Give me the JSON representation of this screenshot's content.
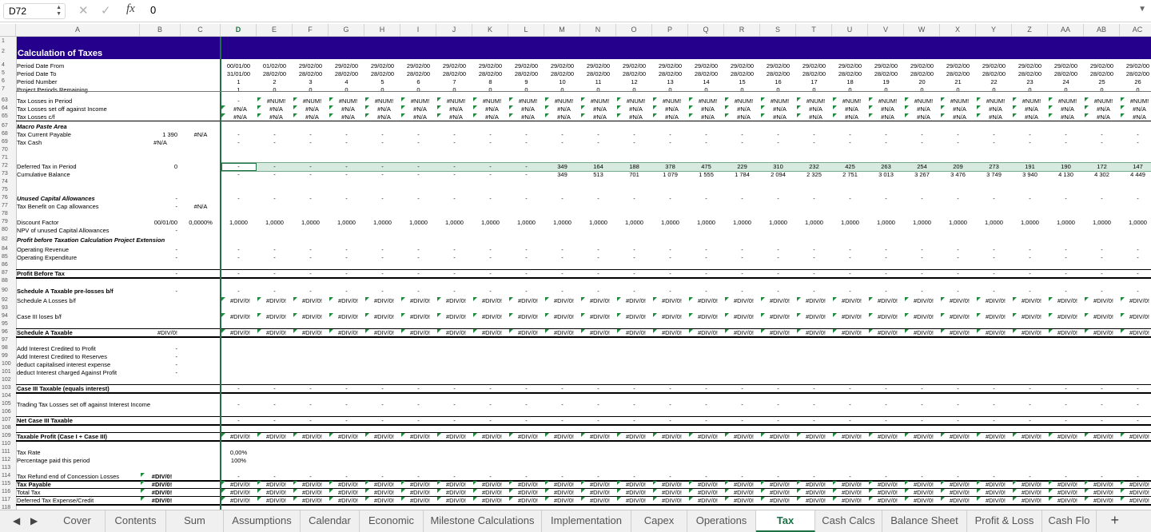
{
  "formula_bar": {
    "cell_ref": "D72",
    "cancel_icon": "close-icon",
    "confirm_icon": "check-icon",
    "fx_label": "fx",
    "formula": "0"
  },
  "columns": [
    {
      "id": "A"
    },
    {
      "id": "B"
    },
    {
      "id": "C"
    },
    {
      "id": "D"
    },
    {
      "id": "E"
    },
    {
      "id": "F"
    },
    {
      "id": "G"
    },
    {
      "id": "H"
    },
    {
      "id": "I"
    },
    {
      "id": "J"
    },
    {
      "id": "K"
    },
    {
      "id": "L"
    },
    {
      "id": "M"
    },
    {
      "id": "N"
    },
    {
      "id": "O"
    },
    {
      "id": "P"
    },
    {
      "id": "Q"
    },
    {
      "id": "R"
    },
    {
      "id": "S"
    },
    {
      "id": "T"
    },
    {
      "id": "U"
    },
    {
      "id": "V"
    },
    {
      "id": "W"
    },
    {
      "id": "X"
    },
    {
      "id": "Y"
    },
    {
      "id": "Z"
    },
    {
      "id": "AA"
    },
    {
      "id": "AB"
    },
    {
      "id": "AC"
    }
  ],
  "selected_column": "D",
  "title": "Calculation of Taxes",
  "header_rows": {
    "period_from": {
      "label": "Period Date From",
      "values": [
        "00/01/00",
        "01/02/00",
        "29/02/00",
        "29/02/00",
        "29/02/00",
        "29/02/00",
        "29/02/00",
        "29/02/00",
        "29/02/00",
        "29/02/00",
        "29/02/00",
        "29/02/00",
        "29/02/00",
        "29/02/00",
        "29/02/00",
        "29/02/00",
        "29/02/00",
        "29/02/00",
        "29/02/00",
        "29/02/00",
        "29/02/00",
        "29/02/00",
        "29/02/00",
        "29/02/00",
        "29/02/00",
        "29/02/00"
      ]
    },
    "period_to": {
      "label": "Period Date To",
      "values": [
        "31/01/00",
        "28/02/00",
        "28/02/00",
        "28/02/00",
        "28/02/00",
        "28/02/00",
        "28/02/00",
        "28/02/00",
        "28/02/00",
        "28/02/00",
        "28/02/00",
        "28/02/00",
        "28/02/00",
        "28/02/00",
        "28/02/00",
        "28/02/00",
        "28/02/00",
        "28/02/00",
        "28/02/00",
        "28/02/00",
        "28/02/00",
        "28/02/00",
        "28/02/00",
        "28/02/00",
        "28/02/00",
        "28/02/00"
      ]
    },
    "period_number": {
      "label": "Period Number",
      "values": [
        "1",
        "2",
        "3",
        "4",
        "5",
        "6",
        "7",
        "8",
        "9",
        "10",
        "11",
        "12",
        "13",
        "14",
        "15",
        "16",
        "17",
        "18",
        "19",
        "20",
        "21",
        "22",
        "23",
        "24",
        "25",
        "26"
      ]
    },
    "periods_remaining": {
      "label": "Project Periods Remaining",
      "values": [
        "1",
        "0",
        "0",
        "0",
        "0",
        "0",
        "0",
        "0",
        "0",
        "0",
        "0",
        "0",
        "0",
        "0",
        "0",
        "0",
        "0",
        "0",
        "0",
        "0",
        "0",
        "0",
        "0",
        "0",
        "0",
        "0"
      ]
    }
  },
  "rows": {
    "r63": {
      "label": "Tax Losses in Period",
      "d": "-",
      "rest": "#NUM!"
    },
    "r64": {
      "label": "Tax Losses set off against Income",
      "d": "#N/A",
      "rest": "#N/A"
    },
    "r65": {
      "label": "Tax Losses c/f",
      "d": "#N/A",
      "rest": "#N/A"
    },
    "r67": {
      "label": "Macro Paste Area"
    },
    "r68": {
      "label": "Tax Current Payable",
      "b": "1 390",
      "c": "#N/A",
      "dash": "-"
    },
    "r69": {
      "label": "Tax Cash",
      "b": "#N/A",
      "dash": "-"
    },
    "r72": {
      "label": "Deferred Tax in Period",
      "b": "0",
      "d": "-",
      "values": [
        "-",
        "-",
        "-",
        "-",
        "-",
        "-",
        "-",
        "-",
        "-",
        "349",
        "164",
        "188",
        "378",
        "475",
        "229",
        "310",
        "232",
        "425",
        "263",
        "254",
        "209",
        "273",
        "191",
        "190",
        "172",
        "147"
      ]
    },
    "r73": {
      "label": "Cumulative Balance",
      "values": [
        "-",
        "-",
        "-",
        "-",
        "-",
        "-",
        "-",
        "-",
        "-",
        "349",
        "513",
        "701",
        "1 079",
        "1 555",
        "1 784",
        "2 094",
        "2 325",
        "2 751",
        "3 013",
        "3 267",
        "3 476",
        "3 749",
        "3 940",
        "4 130",
        "4 302",
        "4 449"
      ]
    },
    "r76": {
      "label": "Unused Capital Allowances",
      "b": "-",
      "dash": "-"
    },
    "r77": {
      "label": "Tax Benefit on Cap allowances",
      "b": "-",
      "c": "#N/A"
    },
    "r79": {
      "label": "Discount Factor",
      "b": "00/01/00",
      "c": "0,0000%",
      "value": "1,0000"
    },
    "r80": {
      "label": "NPV of unused Capital Allowances",
      "b": "-"
    },
    "r82": {
      "label": "Profit before Taxation Calculation Project Extension"
    },
    "r84": {
      "label": "Operating Revenue",
      "b": "-",
      "dash": "-"
    },
    "r85": {
      "label": "Operating Expenditure",
      "b": "-",
      "dash": "-"
    },
    "r87": {
      "label": "Profit Before Tax",
      "b": "-",
      "dash": "-"
    },
    "r90": {
      "label": "Schedule A Taxable pre-losses b/f",
      "b": "-",
      "dash": "-"
    },
    "r92": {
      "label": "Schedule A Losses b/f",
      "value": "#DIV/0!"
    },
    "r94": {
      "label": "Case III loses b/f",
      "value": "#DIV/0!"
    },
    "r96": {
      "label": "Schedule A Taxable",
      "b": "#DIV/0!",
      "value": "#DIV/0!"
    },
    "r98": {
      "label": "Add Interest Credited to Profit",
      "b": "-"
    },
    "r99": {
      "label": "Add Interest Credited to Reserves",
      "b": "-"
    },
    "r100": {
      "label": "deduct capitalised interest expense",
      "b": "-"
    },
    "r101": {
      "label": "deduct Interest charged Against Profit",
      "b": "-"
    },
    "r103": {
      "label": "Case III Taxable (equals interest)",
      "dash": "-"
    },
    "r105": {
      "label": "Trading Tax Losses set off against Interest Income",
      "dash": "-"
    },
    "r107": {
      "label": "Net Case III Taxable",
      "dash": "-"
    },
    "r109": {
      "label": "Taxable Profit (Case I + Case III)",
      "value": "#DIV/0!"
    },
    "r111": {
      "label": "Tax Rate",
      "d": "0,00%"
    },
    "r112": {
      "label": "Percentage paid this period",
      "d": "100%"
    },
    "r114": {
      "label": "Tax Refund end of Concession Losses",
      "b": "#DIV/0!",
      "dash": "-"
    },
    "r115": {
      "label": "Tax Payable",
      "b": "#DIV/0!",
      "value": "#DIV/0!"
    },
    "r116": {
      "label": "Total Tax",
      "b": "#DIV/0!",
      "value": "#DIV/0!"
    },
    "r117": {
      "label": "Deferred Tax Expense/Credit",
      "b": "#DIV/0!",
      "value": "#DIV/0!"
    }
  },
  "row_numbers": [
    "1",
    "2",
    "4",
    "5",
    "6",
    "7",
    "63",
    "64",
    "65",
    "67",
    "68",
    "69",
    "70",
    "71",
    "72",
    "73",
    "74",
    "75",
    "76",
    "77",
    "78",
    "79",
    "80",
    "82",
    "84",
    "85",
    "86",
    "87",
    "88",
    "90",
    "92",
    "93",
    "94",
    "95",
    "96",
    "97",
    "98",
    "99",
    "100",
    "101",
    "102",
    "103",
    "104",
    "105",
    "106",
    "107",
    "108",
    "109",
    "110",
    "111",
    "112",
    "113",
    "114",
    "115",
    "116",
    "117",
    "118"
  ],
  "sheet_tabs": [
    "Cover",
    "Contents",
    "Sum",
    "Assumptions",
    "Calendar",
    "Economic",
    "Milestone Calculations",
    "Implementation",
    "Capex",
    "Operations",
    "Tax",
    "Cash Calcs",
    "Balance Sheet",
    "Profit & Loss",
    "Cash Flo"
  ],
  "active_tab": "Tax",
  "colors": {
    "title_bg": "#24008c",
    "accent": "#1e7145",
    "error_marker": "#1e8c3a"
  }
}
